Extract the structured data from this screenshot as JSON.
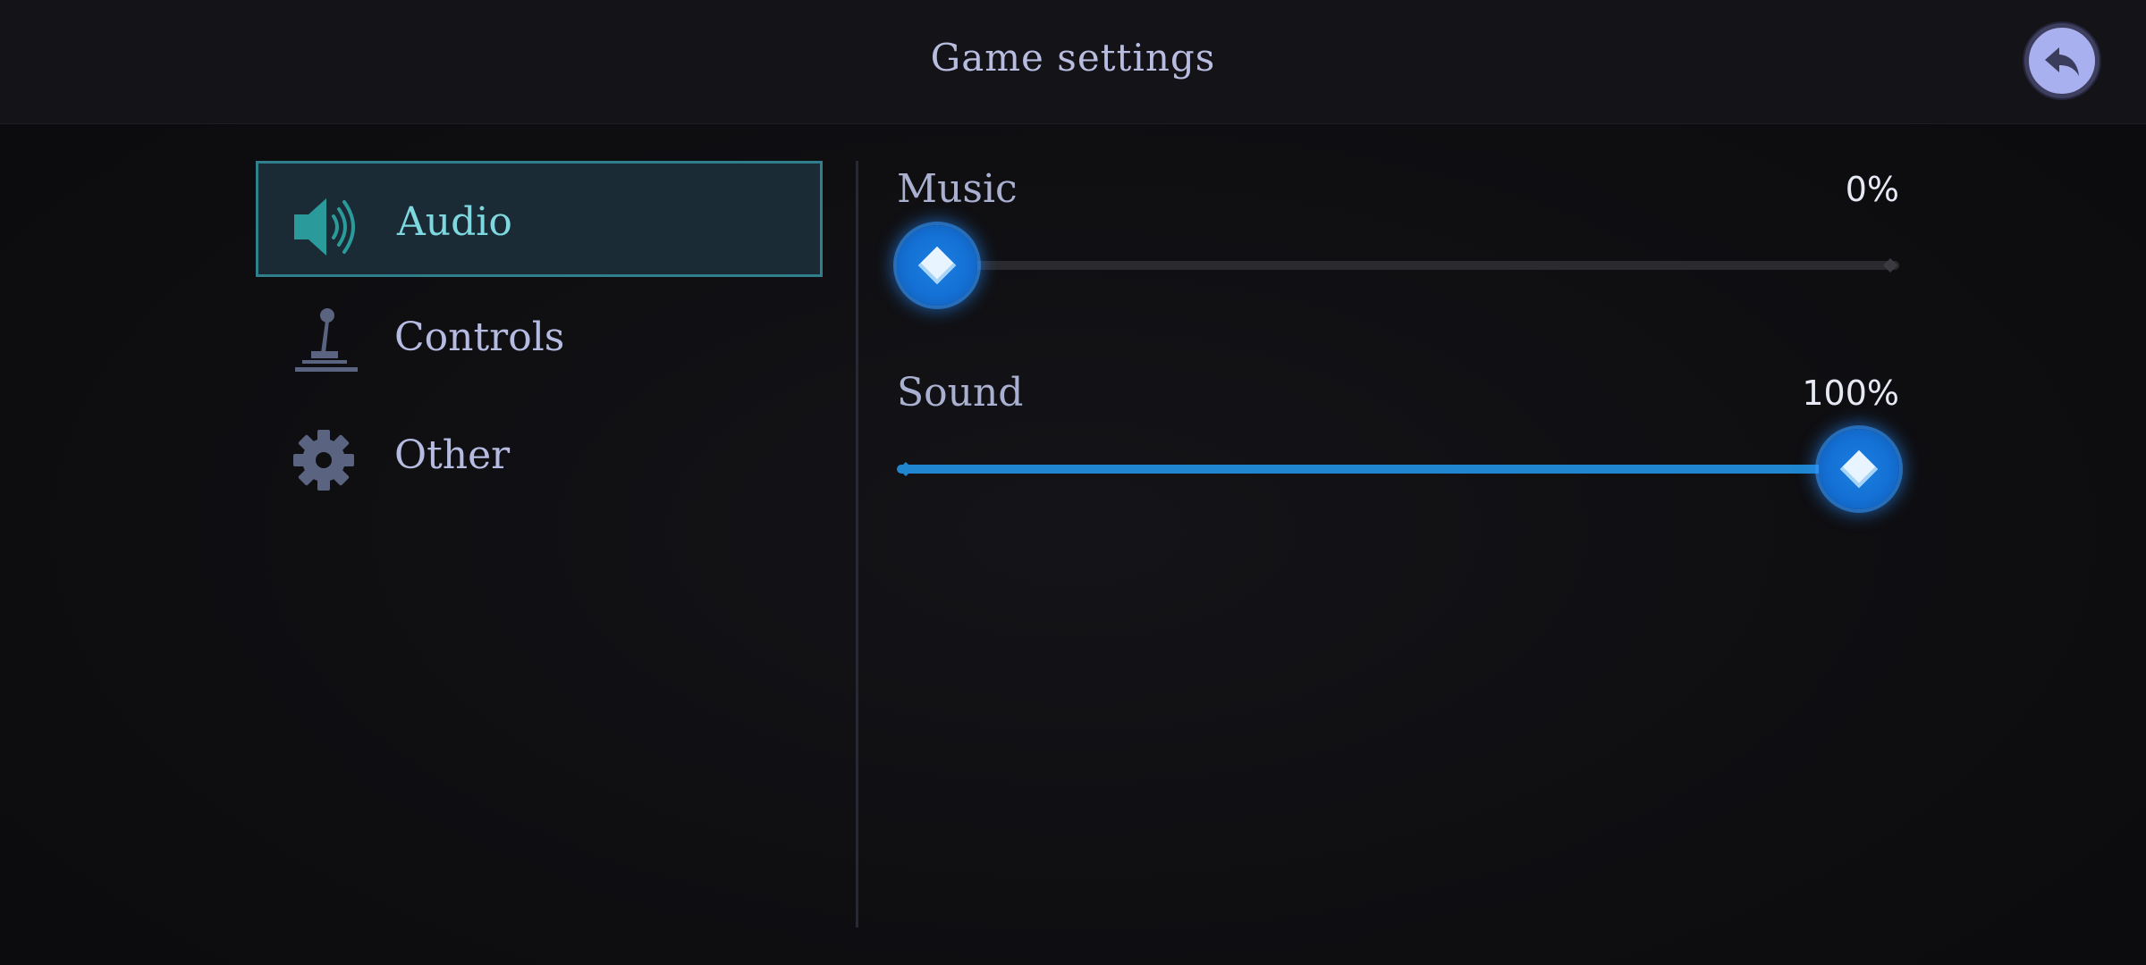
{
  "header": {
    "title": "Game settings",
    "back_icon": "back-arrow-icon"
  },
  "menu": {
    "items": [
      {
        "label": "Audio",
        "icon": "speaker-icon",
        "active": true
      },
      {
        "label": "Controls",
        "icon": "joystick-icon",
        "active": false
      },
      {
        "label": "Other",
        "icon": "gear-icon",
        "active": false
      }
    ]
  },
  "settings": {
    "music": {
      "label": "Music",
      "value_text": "0%",
      "value": 0
    },
    "sound": {
      "label": "Sound",
      "value_text": "100%",
      "value": 100
    }
  },
  "colors": {
    "accent": "#1f86cf",
    "active_border": "#2f7f8c",
    "active_text": "#7ed8e0",
    "back_button": "#a9b0f0"
  }
}
